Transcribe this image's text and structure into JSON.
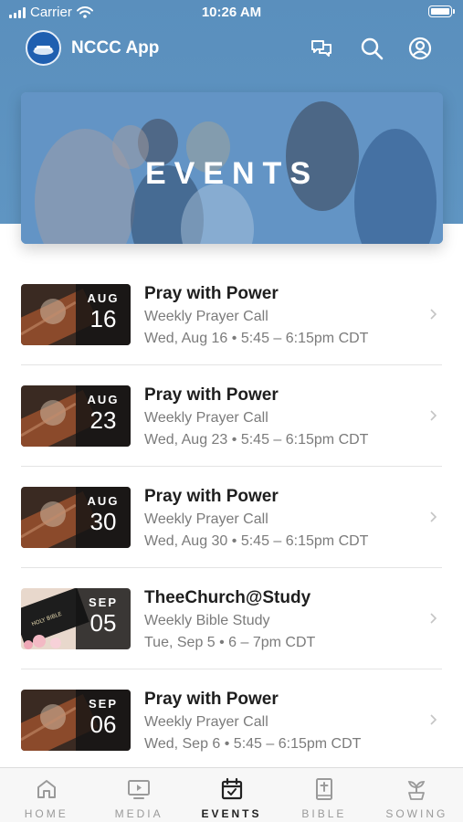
{
  "status_bar": {
    "carrier": "Carrier",
    "time": "10:26 AM"
  },
  "header": {
    "app_name": "NCCC App"
  },
  "hero": {
    "title": "EVENTS"
  },
  "events": [
    {
      "month": "AUG",
      "day": "16",
      "title": "Pray with Power",
      "subtitle": "Weekly Prayer Call",
      "time": "Wed, Aug 16 • 5:45 – 6:15pm CDT"
    },
    {
      "month": "AUG",
      "day": "23",
      "title": "Pray with Power",
      "subtitle": "Weekly Prayer Call",
      "time": "Wed, Aug 23 • 5:45 – 6:15pm CDT"
    },
    {
      "month": "AUG",
      "day": "30",
      "title": "Pray with Power",
      "subtitle": "Weekly Prayer Call",
      "time": "Wed, Aug 30 • 5:45 – 6:15pm CDT"
    },
    {
      "month": "SEP",
      "day": "05",
      "title": "TheeChurch@Study",
      "subtitle": "Weekly Bible Study",
      "time": "Tue, Sep 5 • 6 – 7pm CDT",
      "thumb_text": "HOLY BIBLE"
    },
    {
      "month": "SEP",
      "day": "06",
      "title": "Pray with Power",
      "subtitle": "Weekly Prayer Call",
      "time": "Wed, Sep 6 • 5:45 – 6:15pm CDT"
    }
  ],
  "tabs": [
    {
      "label": "HOME",
      "icon": "home-icon",
      "active": false
    },
    {
      "label": "MEDIA",
      "icon": "media-icon",
      "active": false
    },
    {
      "label": "EVENTS",
      "icon": "calendar-icon",
      "active": true
    },
    {
      "label": "BIBLE",
      "icon": "bible-icon",
      "active": false
    },
    {
      "label": "SOWING",
      "icon": "sprout-icon",
      "active": false
    }
  ],
  "colors": {
    "header_bg": "#5a8fbd",
    "accent": "#1f5fb0",
    "text_primary": "#1e1e1e",
    "text_secondary": "#7b7b7b"
  }
}
